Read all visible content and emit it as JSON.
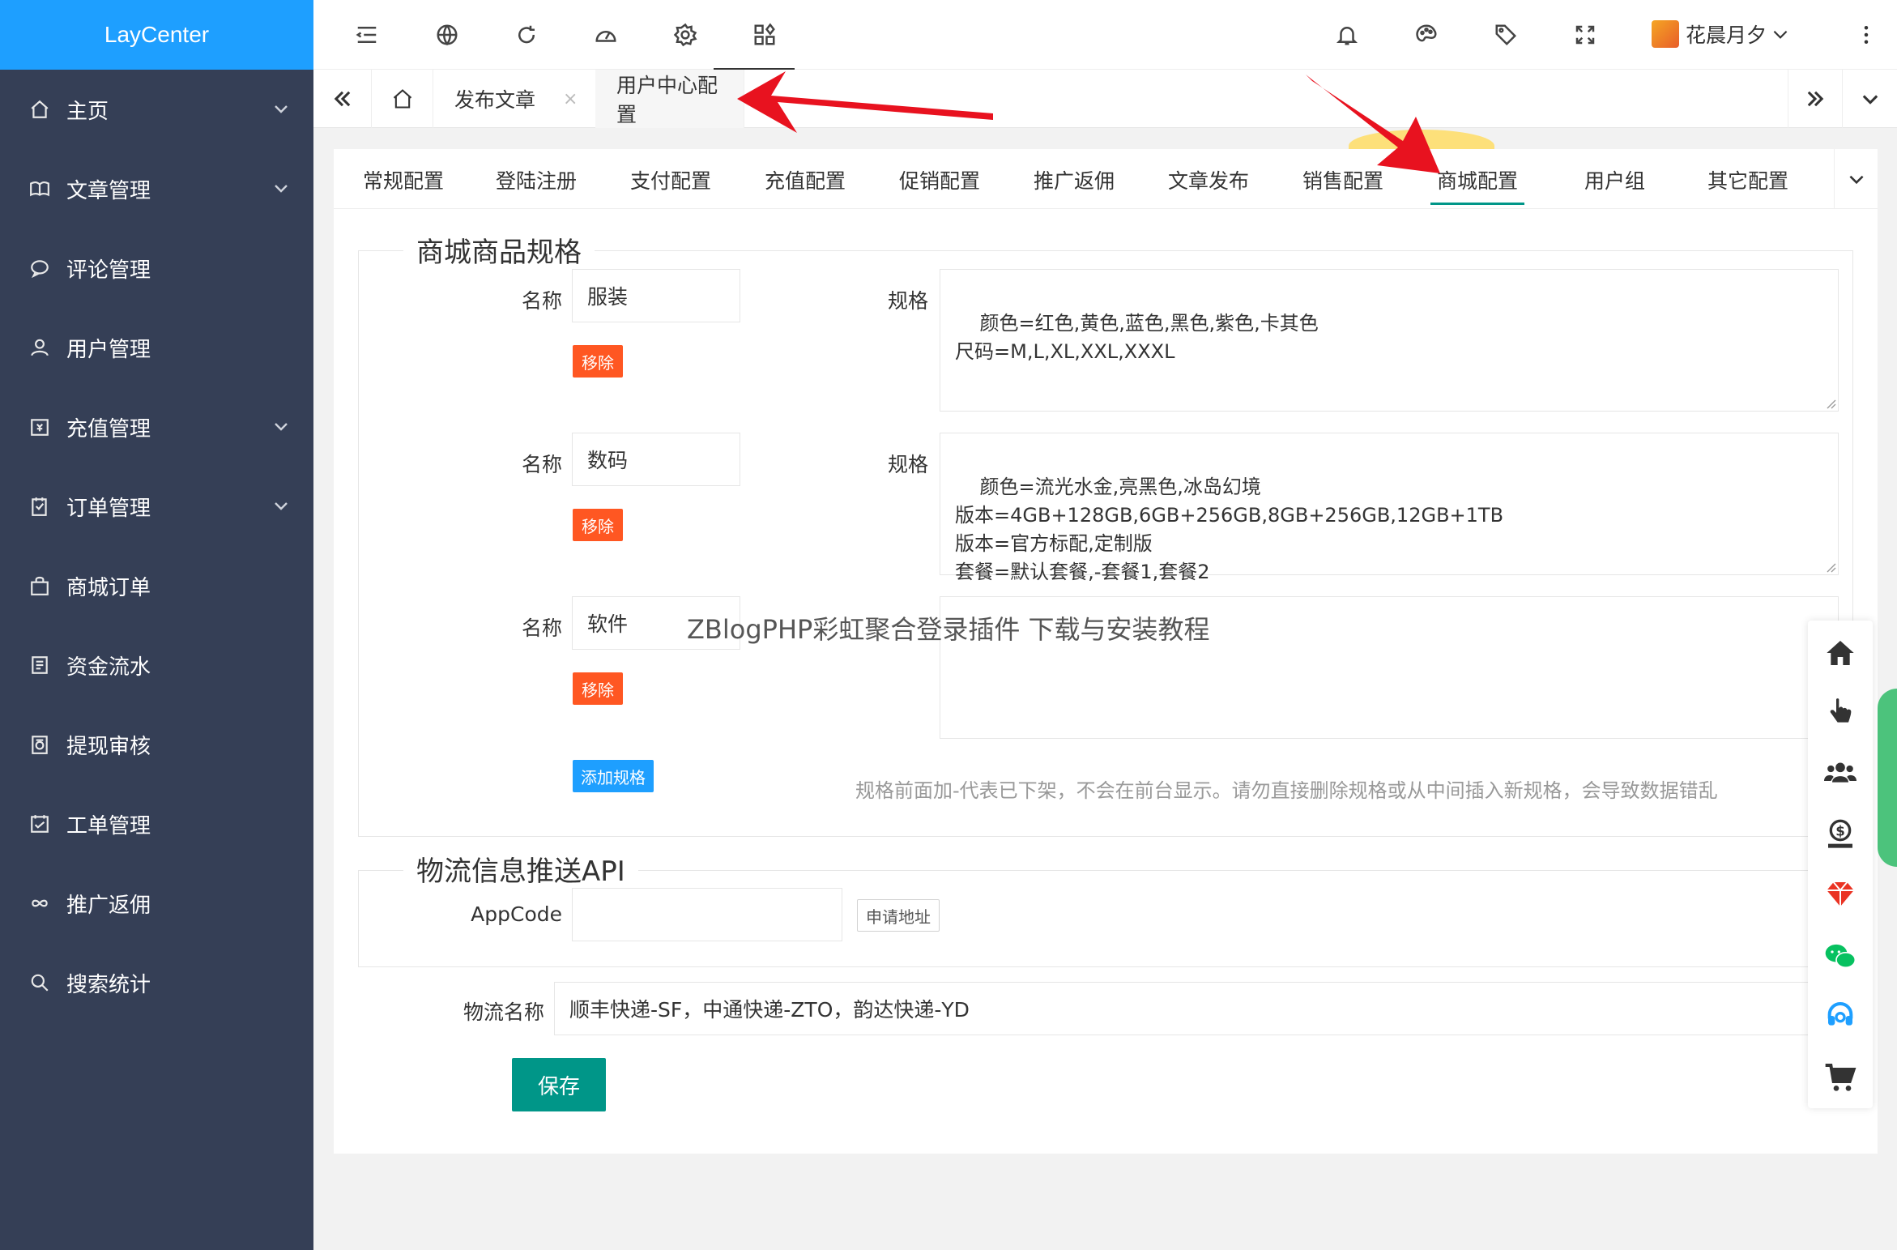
{
  "app": {
    "logo": "LayCenter"
  },
  "sidebar": {
    "items": [
      {
        "label": "主页",
        "icon": "home-icon",
        "has_arrow": true
      },
      {
        "label": "文章管理",
        "icon": "book-icon",
        "has_arrow": true
      },
      {
        "label": "评论管理",
        "icon": "comment-icon",
        "has_arrow": false
      },
      {
        "label": "用户管理",
        "icon": "user-icon",
        "has_arrow": false
      },
      {
        "label": "充值管理",
        "icon": "recharge-icon",
        "has_arrow": true
      },
      {
        "label": "订单管理",
        "icon": "order-icon",
        "has_arrow": true
      },
      {
        "label": "商城订单",
        "icon": "bag-icon",
        "has_arrow": false
      },
      {
        "label": "资金流水",
        "icon": "ledger-icon",
        "has_arrow": false
      },
      {
        "label": "提现审核",
        "icon": "withdraw-icon",
        "has_arrow": false
      },
      {
        "label": "工单管理",
        "icon": "ticket-icon",
        "has_arrow": false
      },
      {
        "label": "推广返佣",
        "icon": "infinity-icon",
        "has_arrow": false
      },
      {
        "label": "搜索统计",
        "icon": "search-icon",
        "has_arrow": false
      }
    ]
  },
  "topbar": {
    "user_name": "花晨月夕"
  },
  "page_tabs": {
    "tab1": "发布文章",
    "tab2": "用户中心配置",
    "close": "×"
  },
  "config_tabs": [
    "常规配置",
    "登陆注册",
    "支付配置",
    "充值配置",
    "促销配置",
    "推广返佣",
    "文章发布",
    "销售配置",
    "商城配置",
    "用户组",
    "其它配置"
  ],
  "shop_specs": {
    "legend": "商城商品规格",
    "name_label": "名称",
    "spec_label": "规格",
    "remove_label": "移除",
    "add_label": "添加规格",
    "hint": "规格前面加-代表已下架，不会在前台显示。请勿直接删除规格或从中间插入新规格，会导致数据错乱",
    "rows": [
      {
        "name": "服装",
        "spec": "颜色=红色,黄色,蓝色,黑色,紫色,卡其色\n尺码=M,L,XL,XXL,XXXL"
      },
      {
        "name": "数码",
        "spec": "颜色=流光水金,亮黑色,冰岛幻境\n版本=4GB+128GB,6GB+256GB,8GB+256GB,12GB+1TB\n版本=官方标配,定制版\n套餐=默认套餐,-套餐1,套餐2"
      },
      {
        "name": "软件",
        "spec": ""
      }
    ]
  },
  "logistics": {
    "legend": "物流信息推送API",
    "appcode_label": "AppCode",
    "appcode_value": "",
    "apply_label": "申请地址",
    "name_label": "物流名称",
    "name_value": "顺丰快递-SF，中通快递-ZTO，韵达快递-YD",
    "save_label": "保存"
  },
  "watermark": "ZBlogPHP彩虹聚合登录插件 下载与安装教程",
  "colors": {
    "sidebar": "#353f56",
    "logo": "#1e9fff",
    "accent": "#009688",
    "danger": "#ff5722",
    "arrow": "#e8121f"
  }
}
